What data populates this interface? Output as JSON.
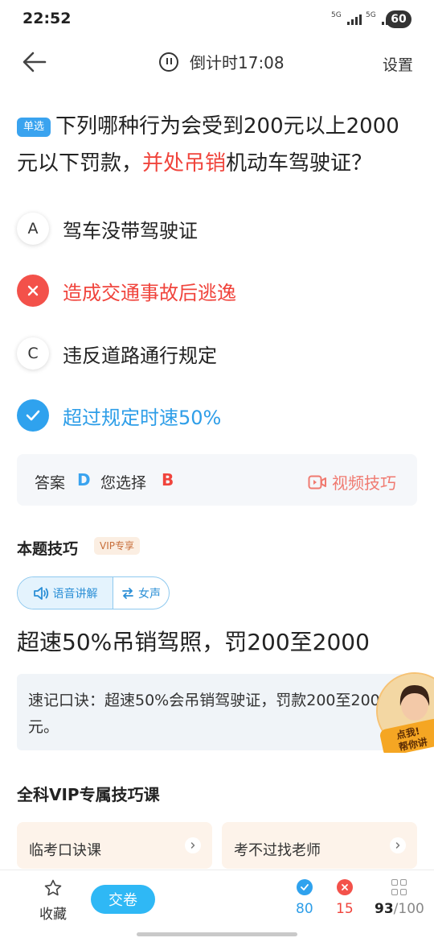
{
  "status_bar": {
    "time": "22:52",
    "net_1": "5G",
    "net_2": "5G",
    "battery": "60"
  },
  "header": {
    "countdown": "倒计时17:08",
    "settings_label": "设置"
  },
  "question": {
    "type_badge": "单选",
    "text_before": "下列哪种行为会受到200元以上2000元以下罚款，",
    "text_highlight": "并处吊销",
    "text_after": "机动车驾驶证？"
  },
  "options": [
    {
      "marker": "A",
      "text": "驾车没带驾驶证",
      "state": "normal"
    },
    {
      "marker": "B",
      "text": "造成交通事故后逃逸",
      "state": "wrong"
    },
    {
      "marker": "C",
      "text": "违反道路通行规定",
      "state": "normal"
    },
    {
      "marker": "D",
      "text": "超过规定时速50%",
      "state": "correct"
    }
  ],
  "answer": {
    "answer_label": "答案",
    "answer_value": "D",
    "choice_label": "您选择",
    "choice_value": "B",
    "video_tip_label": "视频技巧"
  },
  "tips": {
    "title": "本题技巧",
    "vip_tag": "VIP专享",
    "voice_label": "语音讲解",
    "voice_switch_label": "女声",
    "main_tip": "超速50%吊销驾照，罚200至2000",
    "mnemonic": "速记口诀：超速50%会吊销驾驶证，罚款200至2000元。",
    "avatar_caption_1": "点我!",
    "avatar_caption_2": "帮你讲"
  },
  "vip_courses": {
    "title": "全科VIP专属技巧课",
    "items": [
      {
        "label": "临考口诀课"
      },
      {
        "label": "考不过找老师"
      }
    ]
  },
  "bottom_bar": {
    "favorite_label": "收藏",
    "submit_label": "交卷",
    "correct_count": "80",
    "wrong_count": "15",
    "progress_current": "93",
    "progress_total": "/100"
  },
  "colors": {
    "accent_blue": "#2fa2ee",
    "error_red": "#f0443c",
    "submit_blue": "#2fb8f5"
  }
}
